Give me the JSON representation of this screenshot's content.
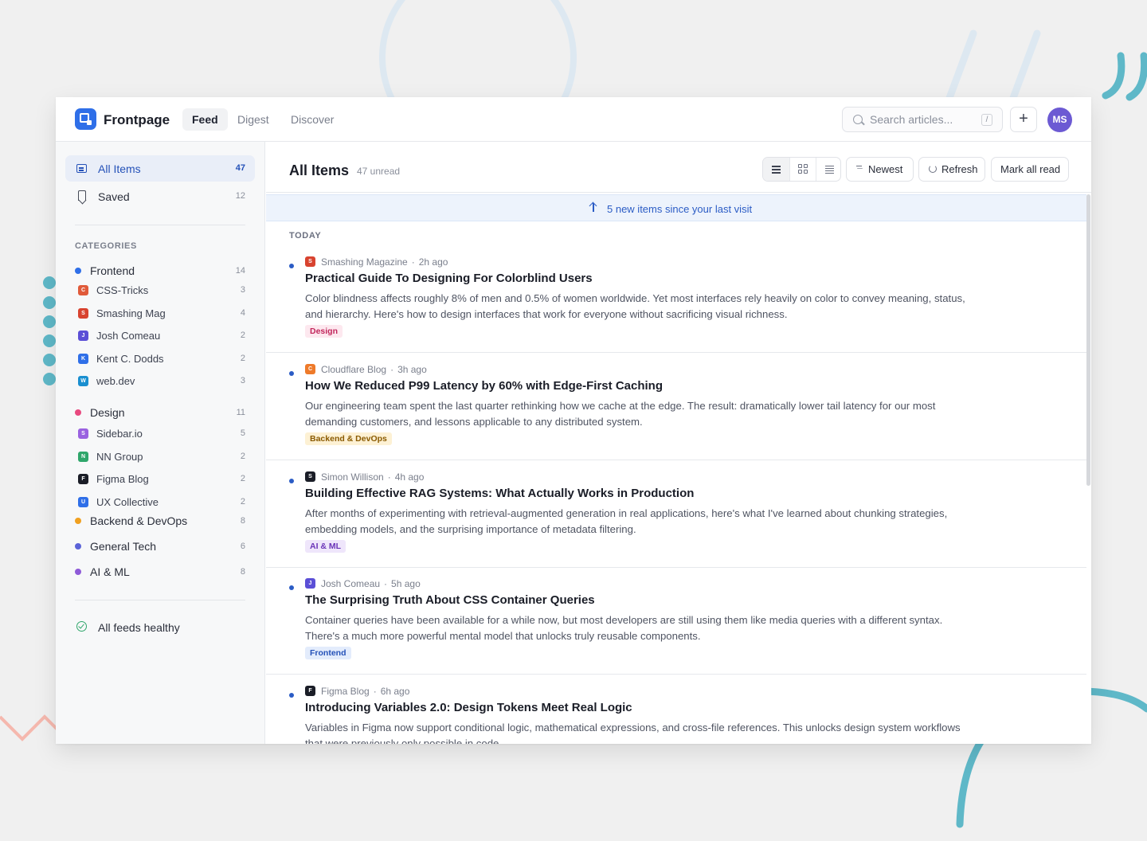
{
  "app": {
    "brand": "Frontpage"
  },
  "header": {
    "tabs": [
      {
        "label": "Feed",
        "active": true
      },
      {
        "label": "Digest",
        "active": false
      },
      {
        "label": "Discover",
        "active": false
      }
    ],
    "search": {
      "placeholder": "Search articles...",
      "shortcut": "/"
    },
    "add_label": "+",
    "avatar_initials": "MS"
  },
  "sidebar": {
    "top_items": [
      {
        "label": "All Items",
        "count": "47",
        "icon": "inbox-icon",
        "active": true
      },
      {
        "label": "Saved",
        "count": "12",
        "icon": "bookmark-icon",
        "active": false
      }
    ],
    "categories_heading": "CATEGORIES",
    "categories": [
      {
        "label": "Frontend",
        "count": "14",
        "color": "#2f6fe8",
        "feeds": [
          {
            "label": "CSS-Tricks",
            "count": "3",
            "letter": "C",
            "color": "#e05a3a"
          },
          {
            "label": "Smashing Mag",
            "count": "4",
            "letter": "S",
            "color": "#d8432f"
          },
          {
            "label": "Josh Comeau",
            "count": "2",
            "letter": "J",
            "color": "#5b4fd6"
          },
          {
            "label": "Kent C. Dodds",
            "count": "2",
            "letter": "K",
            "color": "#2f6fe8"
          },
          {
            "label": "web.dev",
            "count": "3",
            "letter": "W",
            "color": "#1a8fd0"
          }
        ]
      },
      {
        "label": "Design",
        "count": "11",
        "color": "#e8497f",
        "feeds": [
          {
            "label": "Sidebar.io",
            "count": "5",
            "letter": "S",
            "color": "#9a62e0"
          },
          {
            "label": "NN Group",
            "count": "2",
            "letter": "N",
            "color": "#2fa66b"
          },
          {
            "label": "Figma Blog",
            "count": "2",
            "letter": "F",
            "color": "#1a1d27"
          },
          {
            "label": "UX Collective",
            "count": "2",
            "letter": "U",
            "color": "#2f6fe8"
          }
        ]
      },
      {
        "label": "Backend & DevOps",
        "count": "8",
        "color": "#f0a020",
        "feeds": []
      },
      {
        "label": "General Tech",
        "count": "6",
        "color": "#5b63d8",
        "feeds": []
      },
      {
        "label": "AI & ML",
        "count": "8",
        "color": "#8e5ad8",
        "feeds": []
      }
    ],
    "status_label": "All feeds healthy"
  },
  "main": {
    "title": "All Items",
    "unread": "47 unread",
    "sort_label": "Newest",
    "refresh_label": "Refresh",
    "mark_read_label": "Mark all read",
    "banner": "5 new items since your last visit",
    "group_heading": "TODAY",
    "articles": [
      {
        "source": "Smashing Magazine",
        "letter": "S",
        "fav_color": "#d8432f",
        "time": "2h ago",
        "title": "Practical Guide To Designing For Colorblind Users",
        "excerpt": "Color blindness affects roughly 8% of men and 0.5% of women worldwide. Yet most interfaces rely heavily on color to convey meaning, status, and hierarchy. Here's how to design interfaces that work for everyone without sacrificing visual richness.",
        "tag": "Design",
        "tag_bg": "#fde8ef",
        "tag_color": "#c2275c"
      },
      {
        "source": "Cloudflare Blog",
        "letter": "C",
        "fav_color": "#ee7a2a",
        "time": "3h ago",
        "title": "How We Reduced P99 Latency by 60% with Edge-First Caching",
        "excerpt": "Our engineering team spent the last quarter rethinking how we cache at the edge. The result: dramatically lower tail latency for our most demanding customers, and lessons applicable to any distributed system.",
        "tag": "Backend & DevOps",
        "tag_bg": "#fdf1d4",
        "tag_color": "#8a5a00"
      },
      {
        "source": "Simon Willison",
        "letter": "S",
        "fav_color": "#1a1d27",
        "time": "4h ago",
        "title": "Building Effective RAG Systems: What Actually Works in Production",
        "excerpt": "After months of experimenting with retrieval-augmented generation in real applications, here's what I've learned about chunking strategies, embedding models, and the surprising importance of metadata filtering.",
        "tag": "AI & ML",
        "tag_bg": "#efe6fb",
        "tag_color": "#6b35b8"
      },
      {
        "source": "Josh Comeau",
        "letter": "J",
        "fav_color": "#5b4fd6",
        "time": "5h ago",
        "title": "The Surprising Truth About CSS Container Queries",
        "excerpt": "Container queries have been available for a while now, but most developers are still using them like media queries with a different syntax. There's a much more powerful mental model that unlocks truly reusable components.",
        "tag": "Frontend",
        "tag_bg": "#e3ecfc",
        "tag_color": "#2451b8"
      },
      {
        "source": "Figma Blog",
        "letter": "F",
        "fav_color": "#1a1d27",
        "time": "6h ago",
        "title": "Introducing Variables 2.0: Design Tokens Meet Real Logic",
        "excerpt": "Variables in Figma now support conditional logic, mathematical expressions, and cross-file references. This unlocks design system workflows that were previously only possible in code.",
        "tag": "",
        "tag_bg": "#fde8ef",
        "tag_color": "#c2275c"
      }
    ]
  }
}
